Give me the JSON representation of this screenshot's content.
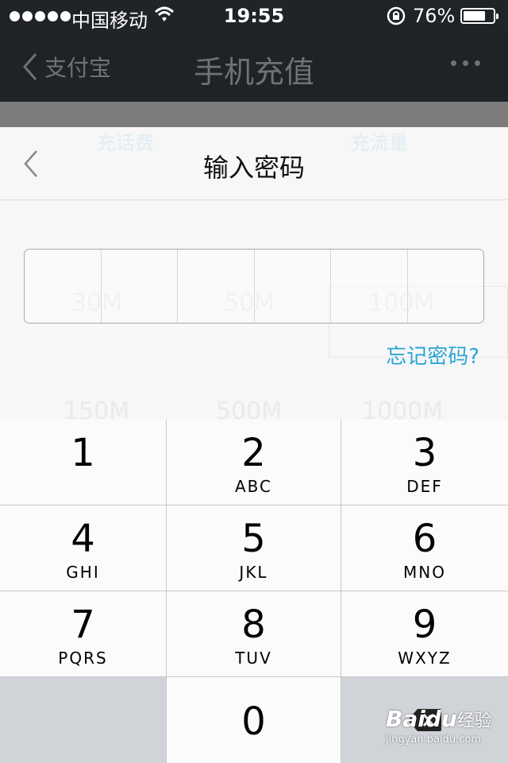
{
  "status_bar": {
    "carrier": "中国移动",
    "time": "19:55",
    "battery": "76%",
    "battery_level": 0.76
  },
  "background_page": {
    "back_label": "支付宝",
    "title": "手机充值",
    "tabs": [
      "充话费",
      "充流量"
    ],
    "data_options": [
      "30M",
      "50M",
      "100M",
      "150M",
      "500M",
      "1000M"
    ]
  },
  "sheet": {
    "title": "输入密码",
    "pin_length": 6,
    "forgot_label": "忘记密码?"
  },
  "keypad": {
    "keys": [
      {
        "digit": "1",
        "letters": ""
      },
      {
        "digit": "2",
        "letters": "ABC"
      },
      {
        "digit": "3",
        "letters": "DEF"
      },
      {
        "digit": "4",
        "letters": "GHI"
      },
      {
        "digit": "5",
        "letters": "JKL"
      },
      {
        "digit": "6",
        "letters": "MNO"
      },
      {
        "digit": "7",
        "letters": "PQRS"
      },
      {
        "digit": "8",
        "letters": "TUV"
      },
      {
        "digit": "9",
        "letters": "WXYZ"
      },
      {
        "digit": "0",
        "letters": ""
      }
    ],
    "delete_icon": "backspace-icon"
  },
  "watermark": {
    "logo": "Baidu",
    "jingyan": "经验",
    "url": "jingyan.baidu.com"
  },
  "colors": {
    "accent": "#2aa6d6",
    "status_bar_bg": "#202327",
    "keypad_bg": "#fbfbfb",
    "keypad_gray": "#d0d3d8"
  }
}
